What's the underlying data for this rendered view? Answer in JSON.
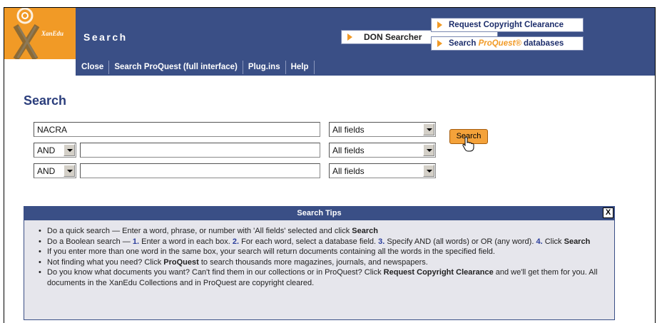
{
  "brand": {
    "logo_text": "XanEdu"
  },
  "header": {
    "title": "Search",
    "don_searcher": "DON Searcher",
    "request_copyright": "Request Copyright Clearance",
    "search_pq_prefix": "Search ",
    "search_pq_brand": "ProQuest®",
    "search_pq_suffix": " databases"
  },
  "nav": {
    "items": [
      "Close",
      "Search ProQuest (full interface)",
      "Plug.ins",
      "Help"
    ]
  },
  "main": {
    "heading": "Search",
    "rows": [
      {
        "operator": "",
        "query": "NACRA",
        "field": "All fields"
      },
      {
        "operator": "AND",
        "query": "",
        "field": "All fields"
      },
      {
        "operator": "AND",
        "query": "",
        "field": "All fields"
      }
    ],
    "search_button": "Search"
  },
  "tips": {
    "title": "Search Tips",
    "close": "X",
    "items": [
      {
        "t1": "Do a quick search — Enter a word, phrase, or number with 'All fields' selected and click ",
        "b1": "Search"
      },
      {
        "t1": "Do a Boolean search — ",
        "n1": "1.",
        "t2": " Enter a word in each box. ",
        "n2": "2.",
        "t3": " For each word, select a database field. ",
        "n3": "3.",
        "t4": " Specify AND (all words) or OR (any word). ",
        "n4": "4.",
        "t5": " Click ",
        "b1": "Search"
      },
      {
        "t1": "If you enter more than one word in the same box, your search will return documents containing all the words in the specified field."
      },
      {
        "t1": "Not finding what you need? Click ",
        "b1": "ProQuest",
        "t2": " to search thousands more magazines, journals, and newspapers."
      },
      {
        "t1": "Do you know what documents you want? Can't find them in our collections or in ProQuest? Click ",
        "b1": "Request Copyright Clearance",
        "t2": " and we'll get them for you. All documents in the XanEdu Collections and in ProQuest are copyright cleared."
      }
    ]
  },
  "colors": {
    "navy": "#3a4f86",
    "orange": "#f19a26"
  }
}
